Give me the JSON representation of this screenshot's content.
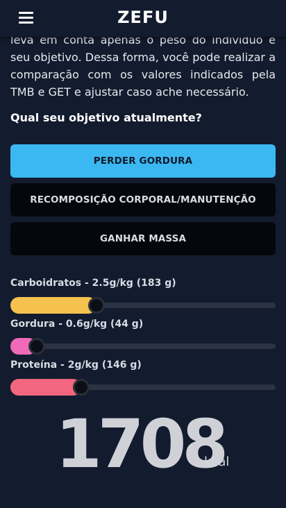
{
  "header": {
    "title": "ZEFU",
    "menu_icon": "menu-icon"
  },
  "intro": {
    "text": "leva em conta apenas o peso do indivíduo e seu objetivo. Dessa forma, você pode realizar a comparação com os valores indicados pela TMB e GET e ajustar caso ache necessário."
  },
  "question": "Qual seu objetivo atualmente?",
  "goals": [
    {
      "label": "PERDER GORDURA",
      "selected": true
    },
    {
      "label": "RECOMPOSIÇÃO CORPORAL/MANUTENÇÃO",
      "selected": false
    },
    {
      "label": "GANHAR MASSA",
      "selected": false
    }
  ],
  "macros": [
    {
      "label": "Carboidratos - 2.5g/kg (183 g)",
      "level": 0.325,
      "color": "#f5c14f"
    },
    {
      "label": "Gordura - 0.6g/kg (44 g)",
      "level": 0.1,
      "color": "#f06ab8"
    },
    {
      "label": "Proteína - 2g/kg (146 g)",
      "level": 0.268,
      "color": "#f26680"
    }
  ],
  "total": {
    "value": "1708",
    "unit": "kcal"
  }
}
